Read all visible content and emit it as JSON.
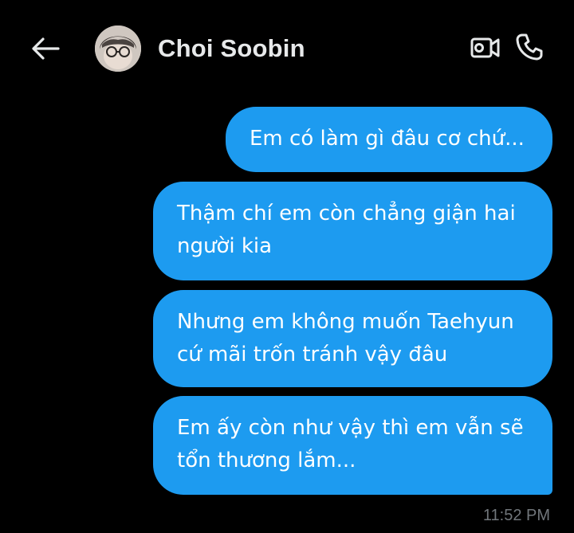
{
  "header": {
    "contact_name": "Choi Soobin",
    "back_icon": "arrow-left-icon",
    "video_icon": "video-camera-icon",
    "call_icon": "phone-icon"
  },
  "messages": [
    {
      "text": "Em có làm gì đâu cơ chứ..."
    },
    {
      "text": "Thậm chí em còn chẳng giận hai\nngười kia"
    },
    {
      "text": "Nhưng em không muốn Taehyun\ncứ mãi trốn tránh vậy đâu"
    },
    {
      "text": "Em ấy còn như vậy thì em vẫn sẽ\ntổn thương lắm..."
    }
  ],
  "timestamp": "11:52 PM",
  "colors": {
    "background": "#000000",
    "bubble": "#1d9bf0",
    "name": "#e7e9ea",
    "timestamp": "#71767b"
  }
}
